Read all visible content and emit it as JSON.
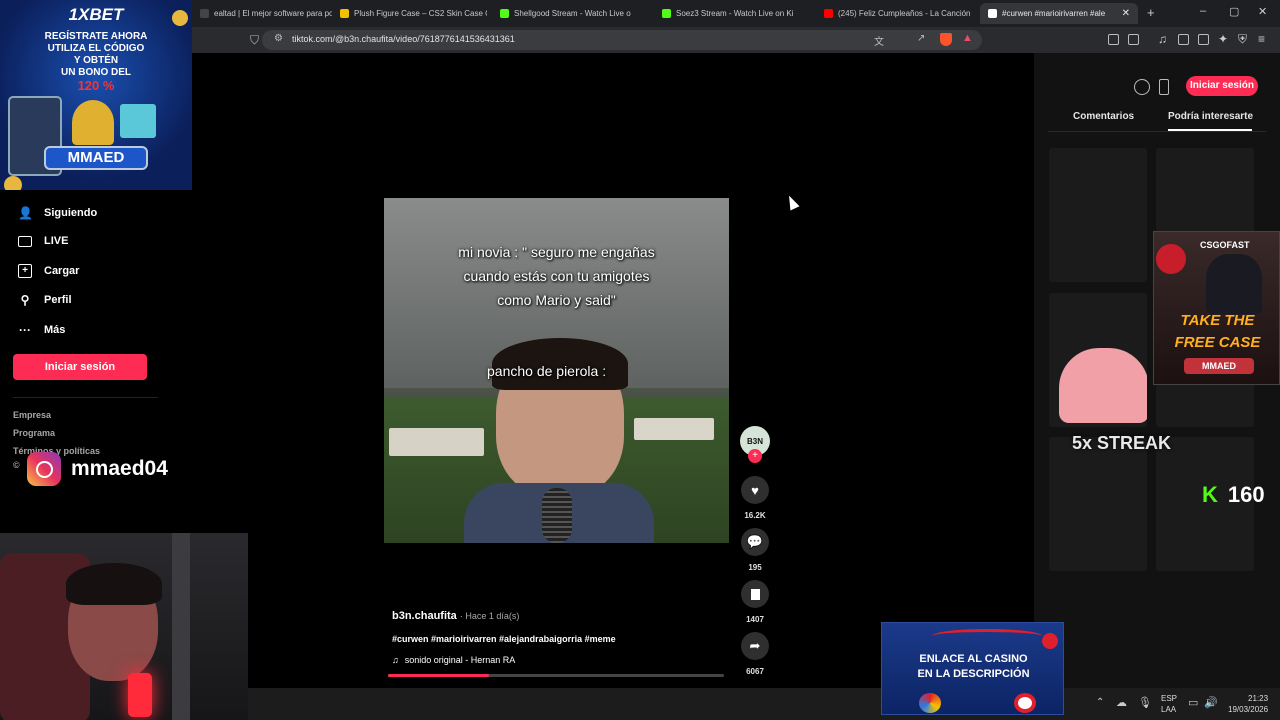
{
  "browser": {
    "tabs": [
      {
        "label": "ealtad | El mejor software para pote",
        "fav": "#444"
      },
      {
        "label": "Plush Figure Case – CS2 Skin Case O",
        "fav": "#f2c200"
      },
      {
        "label": "Shellgood Stream - Watch Live o",
        "fav": "#53fc18"
      },
      {
        "label": "Soez3 Stream - Watch Live on Ki",
        "fav": "#53fc18"
      },
      {
        "label": "(245) Feliz Cumpleaños - La Canción",
        "fav": "#ff0000"
      },
      {
        "label": "#curwen #marioirivarren #ale",
        "fav": "#ffffff"
      }
    ],
    "new_tab": "+",
    "window_controls": [
      "–",
      "▢",
      "✕"
    ],
    "url": "tiktok.com/@b3n.chaufita/video/7618776141536431361"
  },
  "overlay": {
    "ad_brand": "1XBET",
    "ad_text": [
      "REGÍSTRATE AHORA",
      "UTILIZA EL CÓDIGO",
      "Y OBTÉN",
      "UN BONO DEL"
    ],
    "ad_percent": "120 %",
    "ad_code": "MMAED",
    "instagram_handle": "mmaed04",
    "csgo_brand": "CSGOFAST",
    "csgo_slogan": [
      "TAKE THE",
      "FREE CASE"
    ],
    "csgo_code": "MMAED",
    "streak": "5x STREAK",
    "kick_count": "160",
    "casino_text": [
      "ENLACE AL CASINO",
      "EN LA DESCRIPCIÓN"
    ]
  },
  "sidebar": {
    "items": [
      {
        "label": "Siguiendo",
        "icon": "people-icon"
      },
      {
        "label": "LIVE",
        "icon": "live-tv-icon"
      },
      {
        "label": "Cargar",
        "icon": "upload-plus-icon"
      },
      {
        "label": "Perfil",
        "icon": "person-icon"
      },
      {
        "label": "Más",
        "icon": "more-icon"
      }
    ],
    "login_label": "Iniciar sesión",
    "footer": [
      "Empresa",
      "Programa",
      "Términos y políticas",
      "©"
    ]
  },
  "video": {
    "caption_top": [
      "mi novia : \" seguro me engañas",
      "cuando estás con tu amigotes",
      "como Mario y said\""
    ],
    "caption_mid": "pancho de pierola :",
    "progress": 0.3,
    "author": "b3n.chaufita",
    "time_ago": "· Hace 1 día(s)",
    "hashtags": "#curwen #marioirivarren #alejandrabaigorria #meme",
    "sound": "sonido original - Hernan RA",
    "avatar_text": "B3N",
    "likes": "16.2K",
    "comments": "195",
    "saves": "1407",
    "shares": "6067"
  },
  "rightpanel": {
    "login_label": "Iniciar sesión",
    "tabs": [
      "Comentarios",
      "Podría interesarte"
    ]
  },
  "taskbar": {
    "lang": [
      "ESP",
      "LAA"
    ],
    "time": "21:23",
    "date": "19/03/2026"
  }
}
